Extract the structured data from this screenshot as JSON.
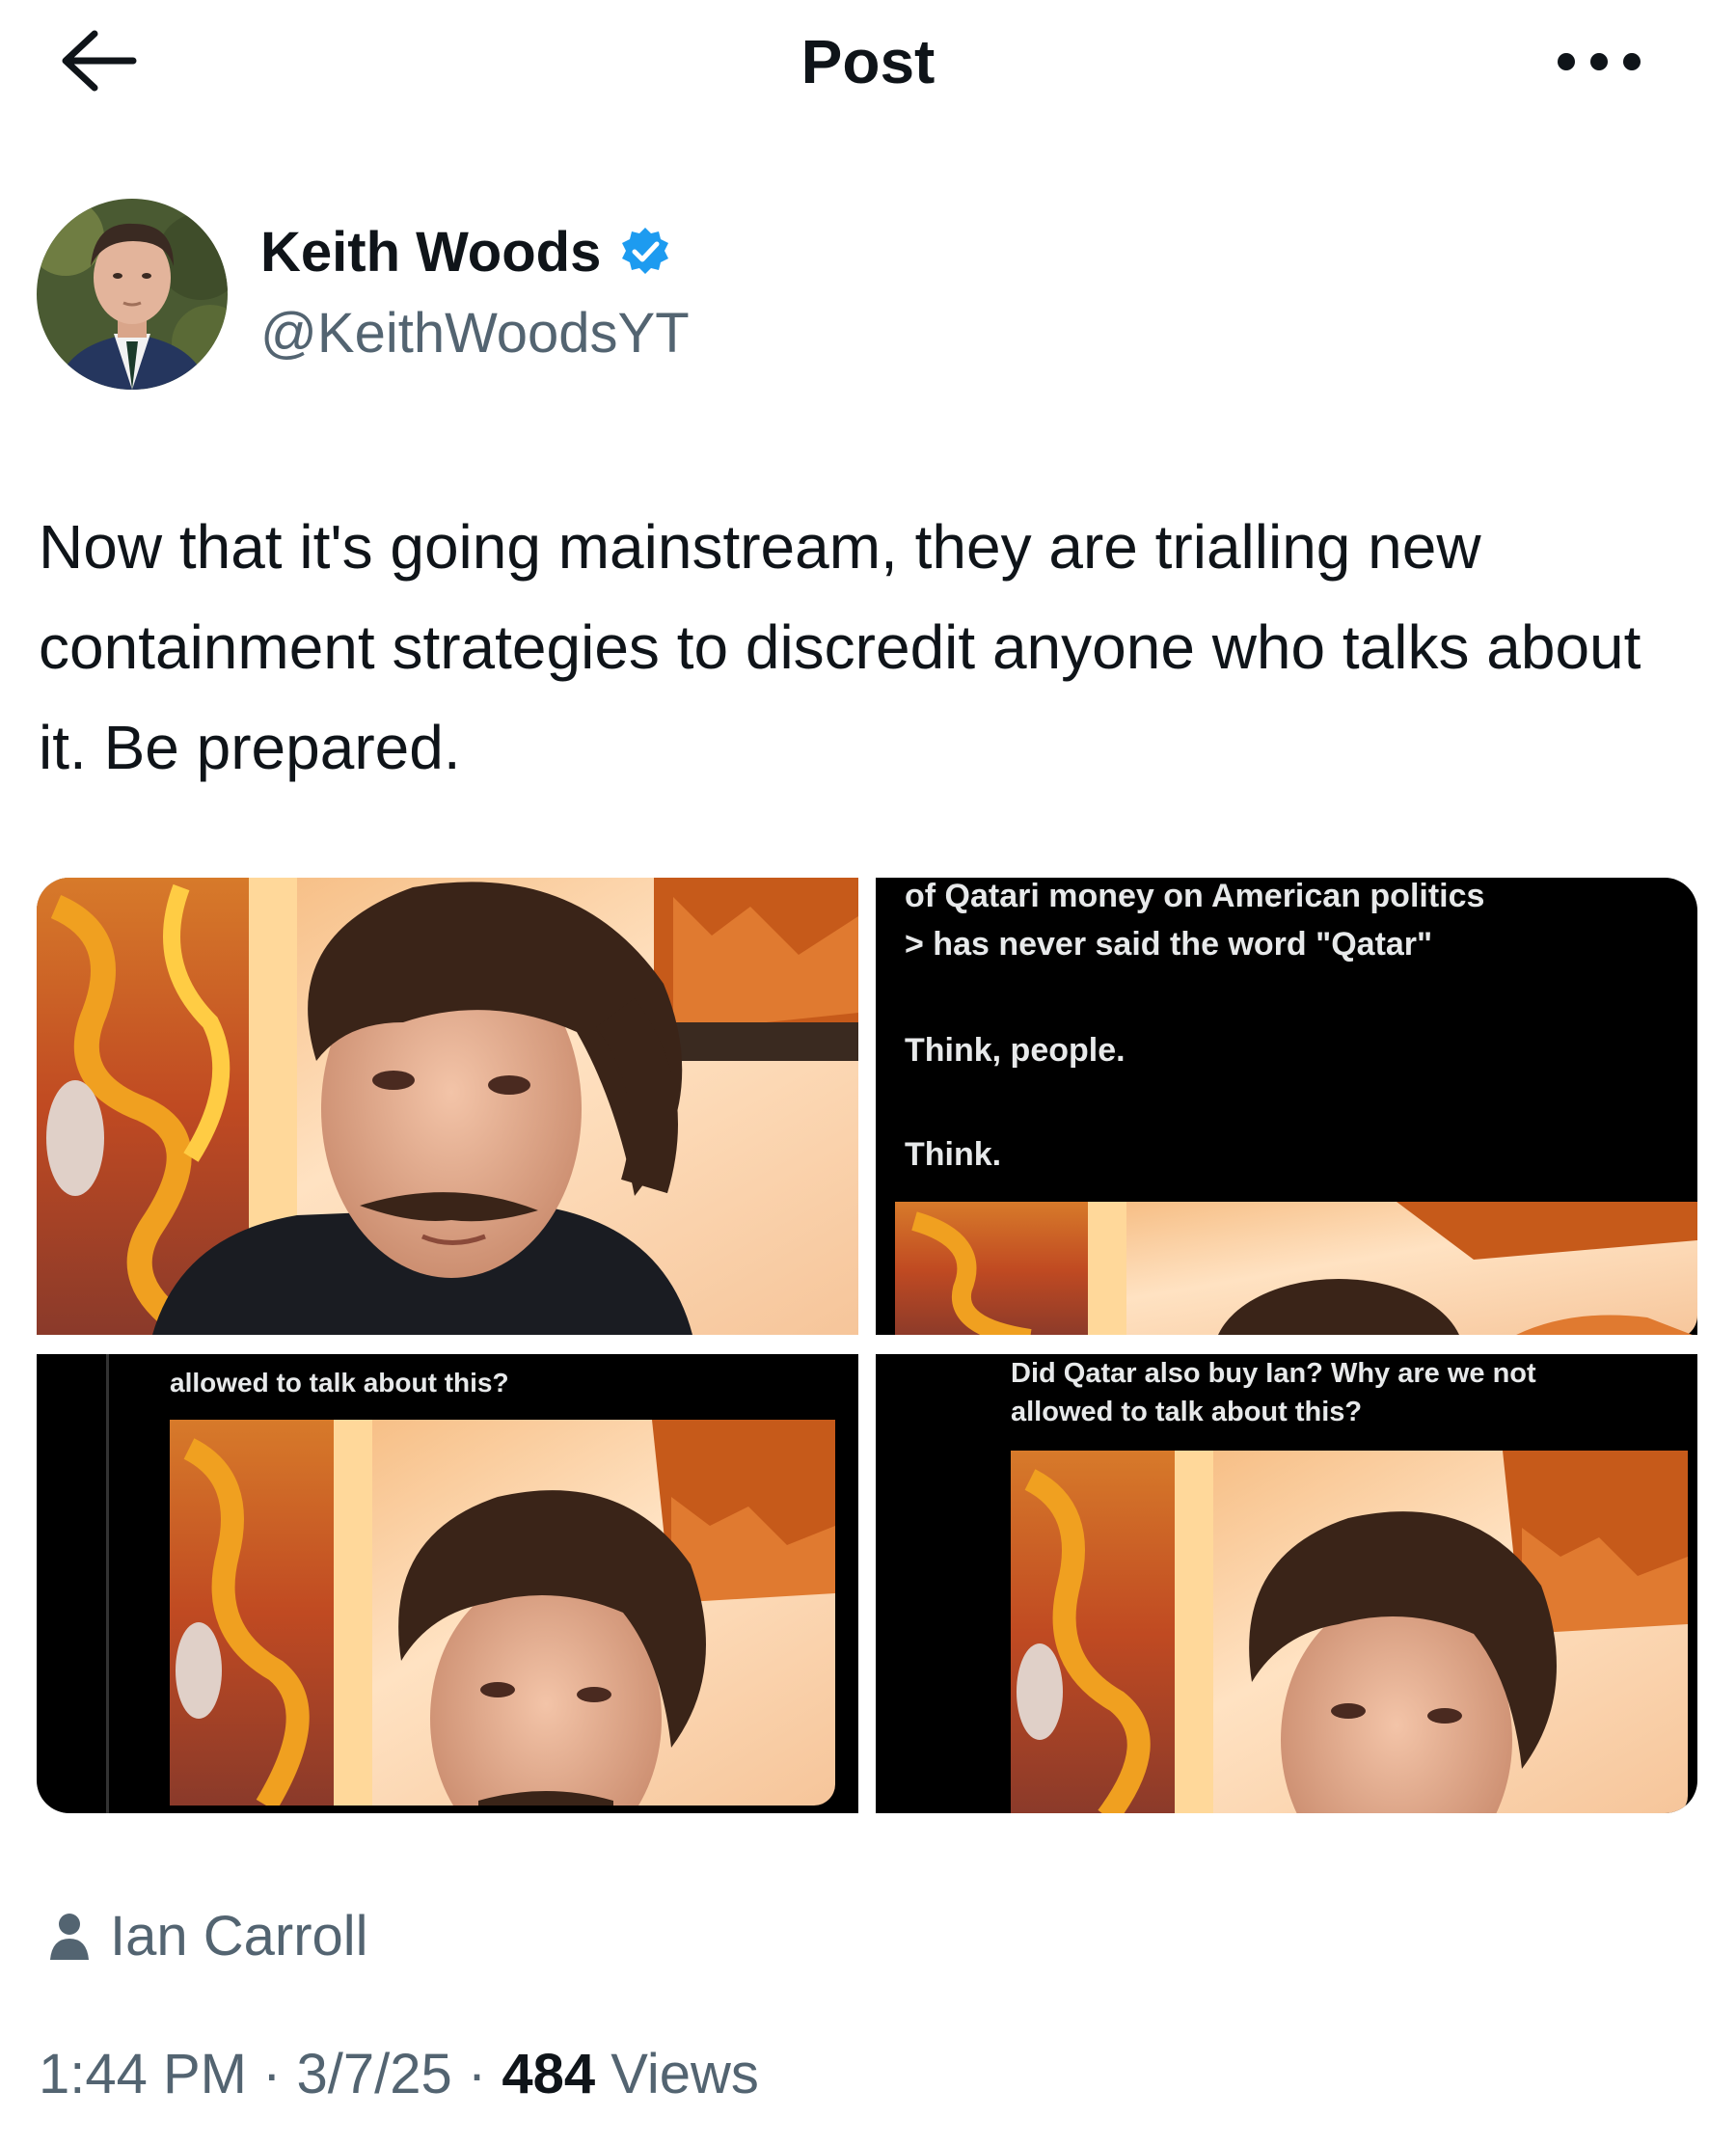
{
  "header": {
    "title": "Post",
    "back_icon": "arrow-left-icon",
    "more_icon": "ellipsis-icon"
  },
  "author": {
    "name": "Keith Woods",
    "handle": "@KeithWoodsYT",
    "verified": true,
    "badge_color": "#1d9bf0"
  },
  "post": {
    "text": "Now that it's going mainstream, they are trialling new containment strategies to discredit anyone who talks about it. Be prepared."
  },
  "media": {
    "image2": {
      "line1": "of Qatari money on American politics",
      "line2": "> has never said the word \"Qatar\"",
      "line3": "Think, people.",
      "line4": "Think."
    },
    "image3": {
      "caption": "allowed to talk about this?"
    },
    "image4": {
      "line1": "Did Qatar also buy Ian? Why are we not",
      "line2": "allowed to talk about this?"
    }
  },
  "attribution": {
    "icon": "person-icon",
    "name": "Ian Carroll"
  },
  "meta": {
    "time": "1:44 PM",
    "sep1": " · ",
    "date": "3/7/25",
    "sep2": " · ",
    "views_count": "484",
    "views_label": " Views"
  },
  "colors": {
    "text": "#0f1419",
    "secondary": "#536471",
    "accent": "#1d9bf0"
  }
}
